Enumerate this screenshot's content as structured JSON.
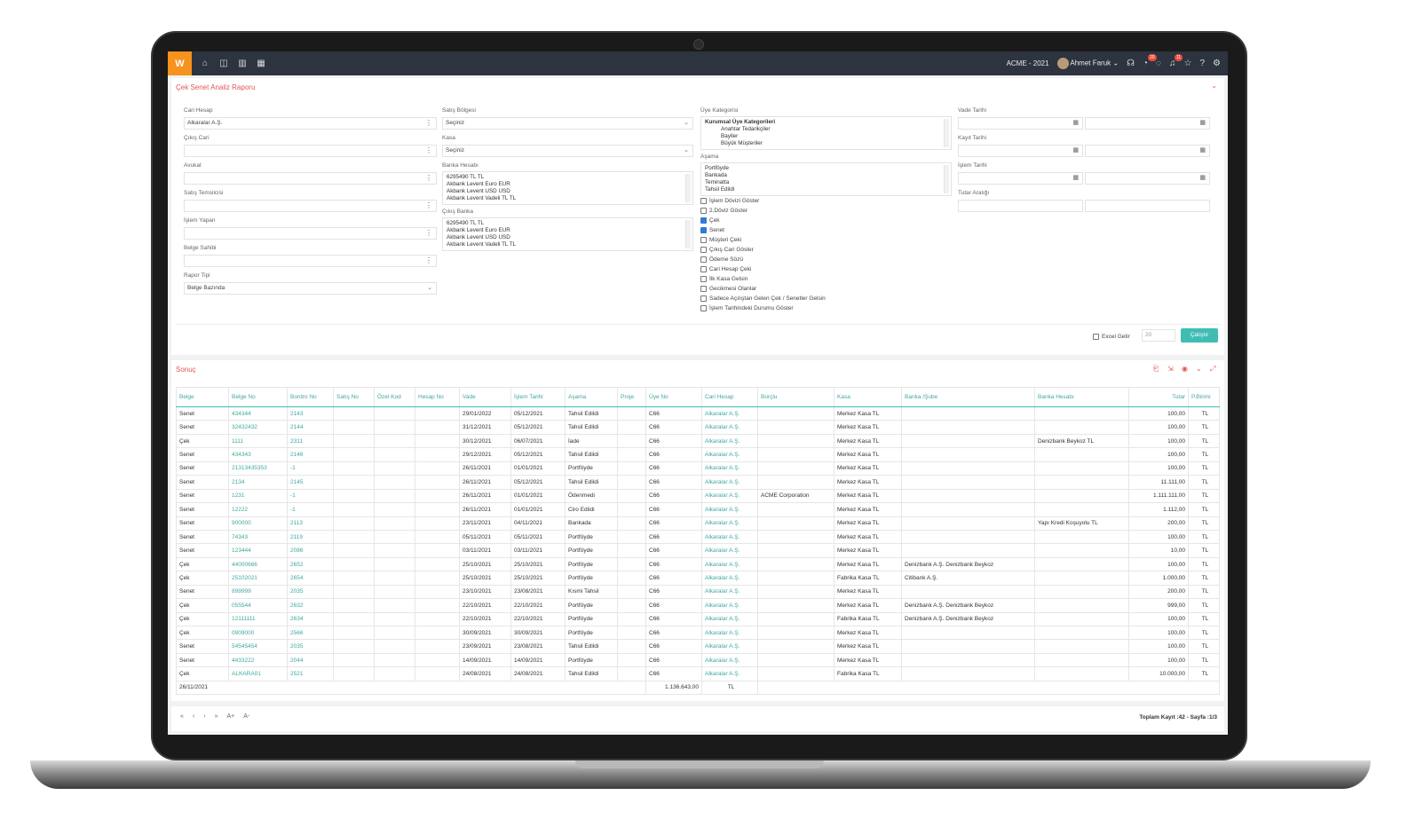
{
  "topbar": {
    "logo": "W",
    "company": "ACME - 2021",
    "user": "Ahmet Faruk",
    "badge_a": "20",
    "badge_b": "11"
  },
  "form": {
    "title": "Çek Senet Analiz Raporu",
    "cari_hesap": {
      "label": "Cari Hesap",
      "value": "Alkaralar A.Ş."
    },
    "cikis_cari": {
      "label": "Çıkış Cari",
      "value": ""
    },
    "avukat": {
      "label": "Avukat",
      "value": ""
    },
    "satis_temsilcisi": {
      "label": "Satış Temsilcisi",
      "value": ""
    },
    "islem_yapan": {
      "label": "İşlem Yapan",
      "value": ""
    },
    "belge_sahibi": {
      "label": "Belge Sahibi",
      "value": ""
    },
    "rapor_tipi": {
      "label": "Rapor Tipi",
      "value": "Belge Bazında"
    },
    "satis_bolgesi": {
      "label": "Satış Bölgesi",
      "value": "Seçiniz"
    },
    "kasa": {
      "label": "Kasa",
      "value": "Seçiniz"
    },
    "banka_hesabi": {
      "label": "Banka Hesabı",
      "items": [
        "6295490 TL TL",
        "Akbank Levent Euro EUR",
        "Akbank Levent USD USD",
        "Akbank Levent Vadeli TL TL"
      ]
    },
    "cikis_banka": {
      "label": "Çıkış Banka",
      "items": [
        "6295490 TL TL",
        "Akbank Levent Euro EUR",
        "Akbank Levent USD USD",
        "Akbank Levent Vadeli TL TL"
      ]
    },
    "uye_kategorisi": {
      "label": "Üye Kategorisi",
      "items": [
        "Kurumsal Üye Kategorileri",
        "Anahtar Tedarikçiler",
        "Bayiler",
        "Büyük Müşteriler"
      ]
    },
    "asama": {
      "label": "Aşama",
      "items": [
        "Portföyde",
        "Bankada",
        "Teminatta",
        "Tahsil Edildi"
      ]
    },
    "checkboxes": [
      {
        "label": "İşlem Dövizi Göster",
        "checked": false
      },
      {
        "label": "2.Döviz Göster",
        "checked": false
      },
      {
        "label": "Çek",
        "checked": true
      },
      {
        "label": "Senet",
        "checked": true
      },
      {
        "label": "Müşteri Çeki",
        "checked": false
      },
      {
        "label": "Çıkış Cari Göster",
        "checked": false
      },
      {
        "label": "Ödeme Sözü",
        "checked": false
      },
      {
        "label": "Cari Hesap Çeki",
        "checked": false
      },
      {
        "label": "İlk Kasa Gelsin",
        "checked": false
      },
      {
        "label": "Gecikmesi Olanlar",
        "checked": false
      },
      {
        "label": "Sadece Açılıştan Gelen Çek / Senetler Gelsin",
        "checked": false
      },
      {
        "label": "İşlem Tarihindeki Durumu Göster",
        "checked": false
      }
    ],
    "vade_tarihi": {
      "label": "Vade Tarihi"
    },
    "kayit_tarihi": {
      "label": "Kayıt Tarihi"
    },
    "islem_tarihi": {
      "label": "İşlem Tarihi"
    },
    "tutar_araligi": {
      "label": "Tutar Aralığı"
    },
    "excel_label": "Excel Getir",
    "page_size": "20",
    "run_label": "Çalıştır"
  },
  "result": {
    "title": "Sonuç",
    "columns": [
      "Belge",
      "Belge No",
      "Bordro No",
      "Satış No",
      "Özel Kod",
      "Hesap No",
      "Vade",
      "İşlem Tarihi",
      "Aşama",
      "Proje",
      "Üye No",
      "Cari Hesap",
      "Borçlu",
      "Kasa",
      "Banka /Şube",
      "Banka Hesabı",
      "Tutar",
      "P.Birimi"
    ],
    "rows": [
      [
        "Senet",
        "434344",
        "2143",
        "",
        "",
        "",
        "29/01/2022",
        "05/12/2021",
        "Tahsil Edildi",
        "",
        "C66",
        "Alkaralar A.Ş.",
        "",
        "Merkez Kasa TL",
        "",
        "",
        "100,00",
        "TL"
      ],
      [
        "Senet",
        "32432432",
        "2144",
        "",
        "",
        "",
        "31/12/2021",
        "05/12/2021",
        "Tahsil Edildi",
        "",
        "C66",
        "Alkaralar A.Ş.",
        "",
        "Merkez Kasa TL",
        "",
        "",
        "100,00",
        "TL"
      ],
      [
        "Çek",
        "1111",
        "2311",
        "",
        "",
        "",
        "30/12/2021",
        "06/07/2021",
        "İade",
        "",
        "C66",
        "Alkaralar A.Ş.",
        "",
        "Merkez Kasa TL",
        "",
        "Denizbank Beykoz TL",
        "100,00",
        "TL"
      ],
      [
        "Senet",
        "434343",
        "2146",
        "",
        "",
        "",
        "29/12/2021",
        "05/12/2021",
        "Tahsil Edildi",
        "",
        "C66",
        "Alkaralar A.Ş.",
        "",
        "Merkez Kasa TL",
        "",
        "",
        "100,00",
        "TL"
      ],
      [
        "Senet",
        "21313435353",
        "-1",
        "",
        "",
        "",
        "26/11/2021",
        "01/01/2021",
        "Portföyde",
        "",
        "C66",
        "Alkaralar A.Ş.",
        "",
        "Merkez Kasa TL",
        "",
        "",
        "100,00",
        "TL"
      ],
      [
        "Senet",
        "2134",
        "2145",
        "",
        "",
        "",
        "26/11/2021",
        "05/12/2021",
        "Tahsil Edildi",
        "",
        "C66",
        "Alkaralar A.Ş.",
        "",
        "Merkez Kasa TL",
        "",
        "",
        "11.111,00",
        "TL"
      ],
      [
        "Senet",
        "1231",
        "-1",
        "",
        "",
        "",
        "26/11/2021",
        "01/01/2021",
        "Ödenmedi",
        "",
        "C66",
        "Alkaralar A.Ş.",
        "ACME Corporation",
        "Merkez Kasa TL",
        "",
        "",
        "1.111.111,00",
        "TL"
      ],
      [
        "Senet",
        "12222",
        "-1",
        "",
        "",
        "",
        "26/11/2021",
        "01/01/2021",
        "Ciro Edildi",
        "",
        "C66",
        "Alkaralar A.Ş.",
        "",
        "Merkez Kasa TL",
        "",
        "",
        "1.112,00",
        "TL"
      ],
      [
        "Senet",
        "900000",
        "2113",
        "",
        "",
        "",
        "23/11/2021",
        "04/11/2021",
        "Bankada",
        "",
        "C66",
        "Alkaralar A.Ş.",
        "",
        "Merkez Kasa TL",
        "",
        "Yapı Kredi Koşuyolu TL",
        "200,00",
        "TL"
      ],
      [
        "Senet",
        "74343",
        "2119",
        "",
        "",
        "",
        "05/11/2021",
        "05/11/2021",
        "Portföyde",
        "",
        "C66",
        "Alkaralar A.Ş.",
        "",
        "Merkez Kasa TL",
        "",
        "",
        "100,00",
        "TL"
      ],
      [
        "Senet",
        "123444",
        "2086",
        "",
        "",
        "",
        "03/11/2021",
        "03/11/2021",
        "Portföyde",
        "",
        "C66",
        "Alkaralar A.Ş.",
        "",
        "Merkez Kasa TL",
        "",
        "",
        "10,00",
        "TL"
      ],
      [
        "Çek",
        "44000666",
        "2652",
        "",
        "",
        "",
        "25/10/2021",
        "25/10/2021",
        "Portföyde",
        "",
        "C66",
        "Alkaralar A.Ş.",
        "",
        "Merkez Kasa TL",
        "Denizbank A.Ş. Denizbank Beykoz",
        "",
        "100,00",
        "TL"
      ],
      [
        "Çek",
        "25102021",
        "2654",
        "",
        "",
        "",
        "25/10/2021",
        "25/10/2021",
        "Portföyde",
        "",
        "C66",
        "Alkaralar A.Ş.",
        "",
        "Fabrika Kasa TL",
        "Citibank A.Ş.",
        "",
        "1.000,00",
        "TL"
      ],
      [
        "Senet",
        "899999",
        "2035",
        "",
        "",
        "",
        "23/10/2021",
        "23/08/2021",
        "Kısmi Tahsil",
        "",
        "C66",
        "Alkaralar A.Ş.",
        "",
        "Merkez Kasa TL",
        "",
        "",
        "200,00",
        "TL"
      ],
      [
        "Çek",
        "055544",
        "2632",
        "",
        "",
        "",
        "22/10/2021",
        "22/10/2021",
        "Portföyde",
        "",
        "C66",
        "Alkaralar A.Ş.",
        "",
        "Merkez Kasa TL",
        "Denizbank A.Ş. Denizbank Beykoz",
        "",
        "999,00",
        "TL"
      ],
      [
        "Çek",
        "12111111",
        "2634",
        "",
        "",
        "",
        "22/10/2021",
        "22/10/2021",
        "Portföyde",
        "",
        "C66",
        "Alkaralar A.Ş.",
        "",
        "Fabrika Kasa TL",
        "Denizbank A.Ş. Denizbank Beykoz",
        "",
        "100,00",
        "TL"
      ],
      [
        "Çek",
        "0909000",
        "2566",
        "",
        "",
        "",
        "30/09/2021",
        "30/09/2021",
        "Portföyde",
        "",
        "C66",
        "Alkaralar A.Ş.",
        "",
        "Merkez Kasa TL",
        "",
        "",
        "100,00",
        "TL"
      ],
      [
        "Senet",
        "54545454",
        "2035",
        "",
        "",
        "",
        "23/09/2021",
        "23/08/2021",
        "Tahsil Edildi",
        "",
        "C66",
        "Alkaralar A.Ş.",
        "",
        "Merkez Kasa TL",
        "",
        "",
        "100,00",
        "TL"
      ],
      [
        "Senet",
        "4433222",
        "2044",
        "",
        "",
        "",
        "14/09/2021",
        "14/09/2021",
        "Portföyde",
        "",
        "C66",
        "Alkaralar A.Ş.",
        "",
        "Merkez Kasa TL",
        "",
        "",
        "100,00",
        "TL"
      ],
      [
        "Çek",
        "ALKARA01",
        "2521",
        "",
        "",
        "",
        "24/08/2021",
        "24/08/2021",
        "Tahsil Edildi",
        "",
        "C66",
        "Alkaralar A.Ş.",
        "",
        "Fabrika Kasa TL",
        "",
        "",
        "10.000,00",
        "TL"
      ]
    ],
    "footer_date": "26/11/2021",
    "footer_total": "1.136.643,00",
    "footer_currency": "TL"
  },
  "pager": {
    "first": "«",
    "prev": "‹",
    "next": "›",
    "last": "»",
    "font_up": "A+",
    "font_down": "A-",
    "total_label": "Toplam Kayıt :42 -",
    "page_label": "Sayfa :1/3"
  }
}
